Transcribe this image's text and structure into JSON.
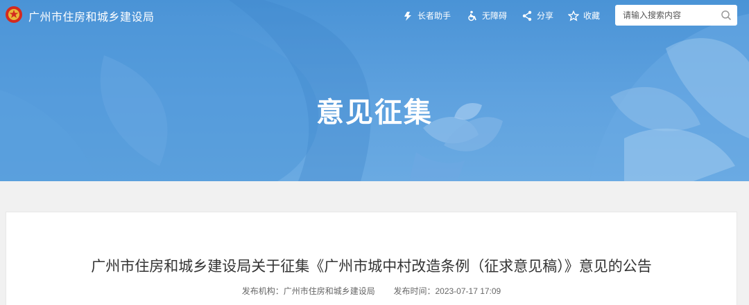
{
  "header": {
    "site_name": "广州市住房和城乡建设局",
    "tools": [
      {
        "label": "长者助手",
        "icon": "elder-icon"
      },
      {
        "label": "无障碍",
        "icon": "wheelchair-icon"
      },
      {
        "label": "分享",
        "icon": "share-icon"
      },
      {
        "label": "收藏",
        "icon": "star-icon"
      }
    ],
    "search": {
      "placeholder": "请输入搜索内容",
      "icon": "search-icon"
    }
  },
  "banner": {
    "title": "意见征集"
  },
  "article": {
    "title": "广州市住房和城乡建设局关于征集《广州市城中村改造条例（征求意见稿）》意见的公告",
    "publisher_label": "发布机构：",
    "publisher": "广州市住房和城乡建设局",
    "time_label": "发布时间：",
    "time": "2023-07-17 17:09"
  },
  "colors": {
    "banner": "#5a9fdc",
    "page_bg": "#f1f1f1",
    "title_text": "#333333"
  }
}
